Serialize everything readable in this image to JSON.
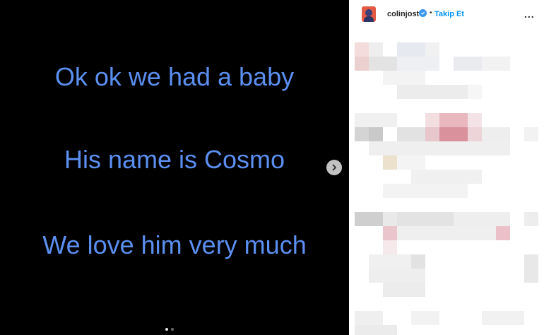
{
  "post": {
    "captions": [
      "Ok ok we had a baby",
      "His name is Cosmo",
      "We love him very much"
    ]
  },
  "header": {
    "username": "colinjost",
    "separator": "•",
    "follow_label": "Takip Et",
    "more_label": "..."
  },
  "carousel": {
    "slide_count": 2,
    "active_index": 0
  },
  "colors": {
    "caption_text": "#5b8ff0",
    "media_bg": "#000000",
    "follow": "#0095f6",
    "verified": "#3897f0"
  },
  "icons": {
    "next": "chevron-right-icon",
    "verified": "verified-badge-icon",
    "more": "more-options-icon"
  }
}
